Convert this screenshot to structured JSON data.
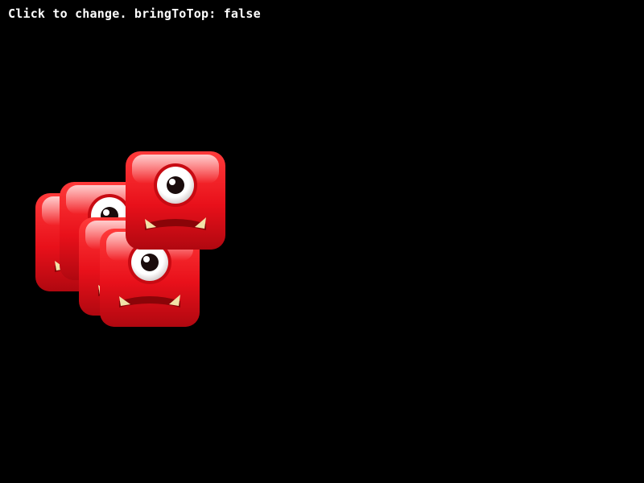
{
  "status": {
    "text": "Click to change. bringToTop: false"
  },
  "sprites": {
    "icon": "red-cyclops-monster-icon",
    "count": 5,
    "colors": {
      "body": "#e8101a",
      "body_dark": "#b00810",
      "highlight": "#ff8a8a",
      "eye_white": "#ffffff",
      "pupil": "#1a0c0c",
      "fang": "#f2e2a8"
    }
  }
}
